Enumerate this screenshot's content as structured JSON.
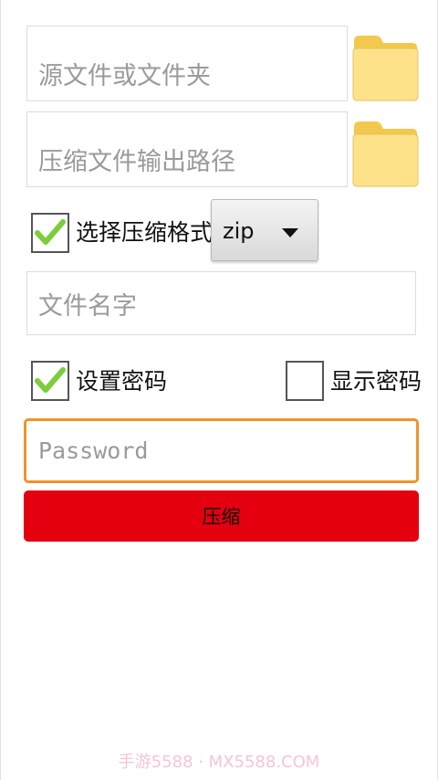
{
  "form": {
    "source_placeholder": "源文件或文件夹",
    "output_placeholder": "压缩文件输出路径",
    "format_checkbox": {
      "label": "选择压缩格式",
      "checked": true
    },
    "format_selected": "zip",
    "filename_placeholder": "文件名字",
    "set_password": {
      "label": "设置密码",
      "checked": true
    },
    "show_password": {
      "label": "显示密码",
      "checked": false
    },
    "password_placeholder": "Password",
    "compress_button_label": "压缩"
  },
  "icons": {
    "source_browse": "folder-icon",
    "output_browse": "folder-icon",
    "checkmark": "check-icon",
    "dropdown": "caret-down-icon"
  },
  "colors": {
    "accent_button": "#e4000f",
    "focus_border": "#f0932a",
    "checkmark": "#7ccd3a",
    "folder": "#fbd96a"
  },
  "watermark": "手游5588 · MX5588.COM"
}
